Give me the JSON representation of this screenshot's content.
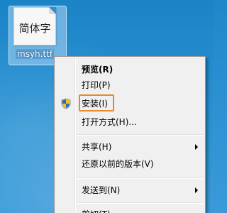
{
  "desktop": {
    "file": {
      "icon_text": "简体字",
      "name": "msyh.ttf"
    }
  },
  "context_menu": {
    "items": [
      {
        "label": "预览(R)",
        "bold": true
      },
      {
        "label": "打印(P)"
      },
      {
        "label": "安装(I)",
        "icon": "shield-icon",
        "highlighted": true
      },
      {
        "label": "打开方式(H)..."
      },
      {
        "label": "共享(H)",
        "submenu": true
      },
      {
        "label": "还原以前的版本(V)"
      },
      {
        "label": "发送到(N)",
        "submenu": true
      },
      {
        "label": "剪切(T)"
      }
    ],
    "highlight_color": "#e8872e"
  }
}
